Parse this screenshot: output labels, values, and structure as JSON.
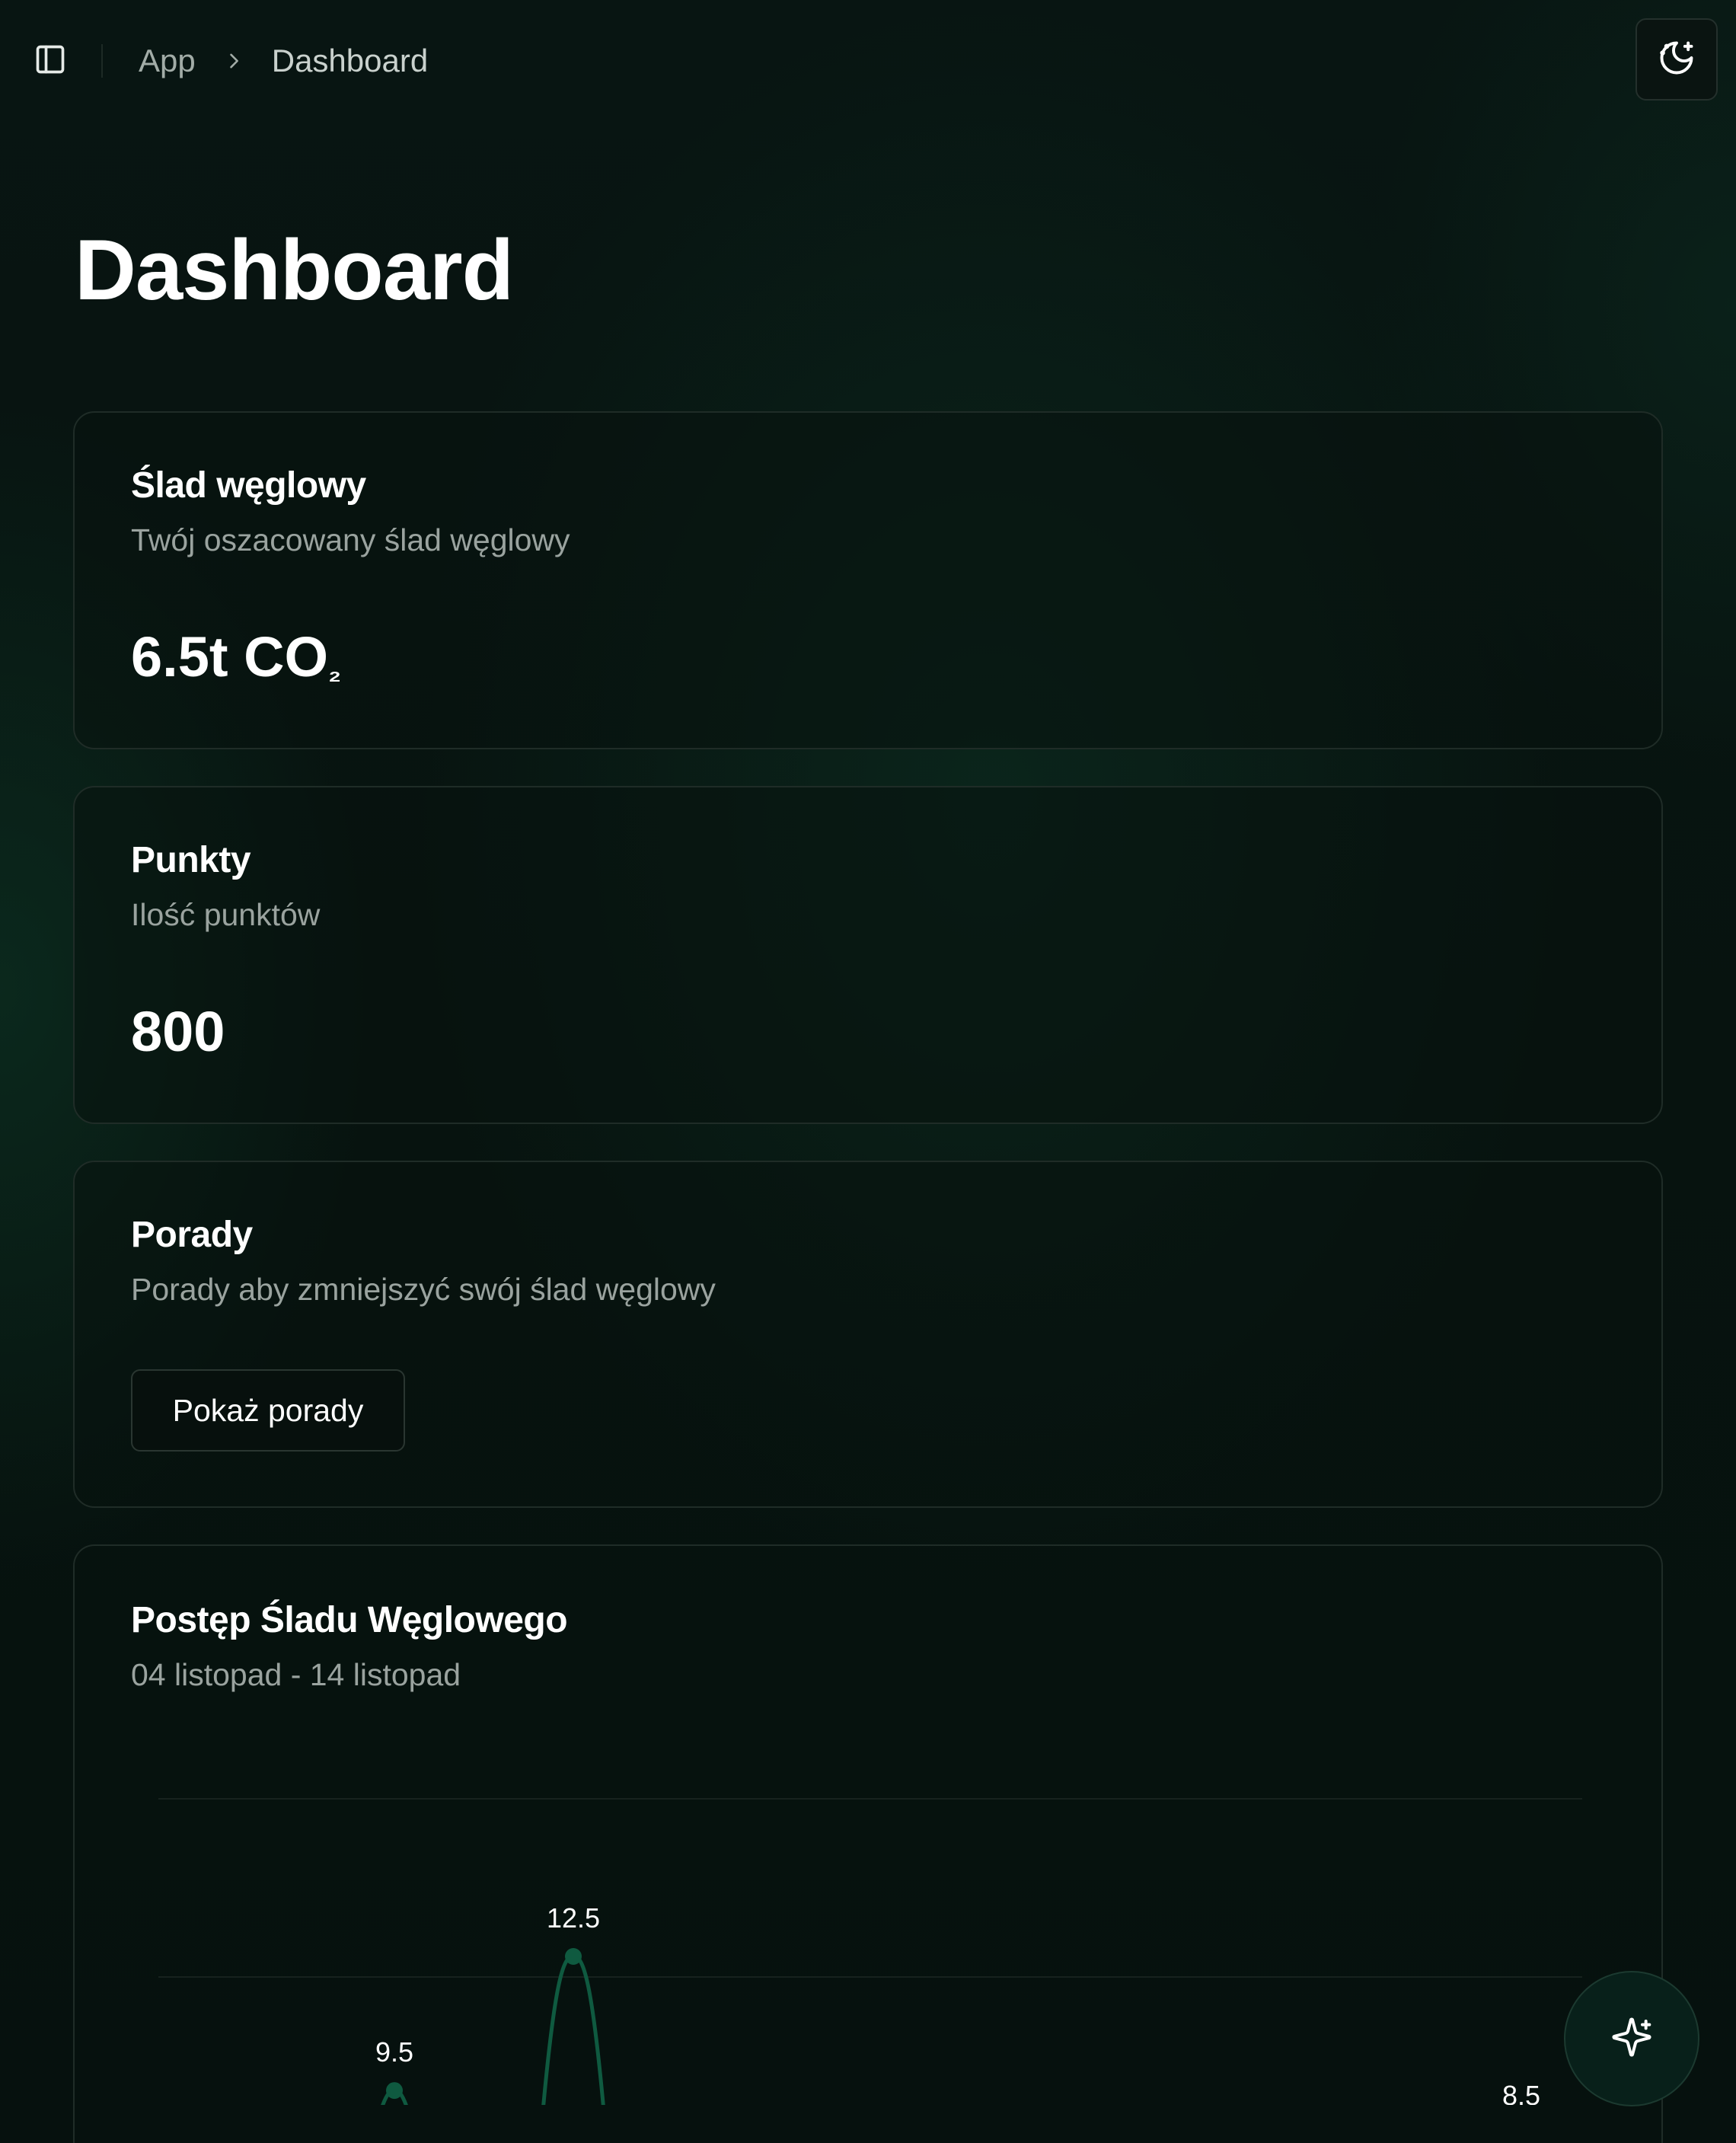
{
  "breadcrumb": {
    "items": [
      "App",
      "Dashboard"
    ]
  },
  "header": {
    "title": "Dashboard"
  },
  "icons": {
    "sidebar": "sidebar-toggle-icon",
    "chevron": "chevron-right-icon",
    "theme": "moon-stars-icon",
    "assistant": "sparkles-icon"
  },
  "cards": {
    "carbon": {
      "title": "Ślad węglowy",
      "description": "Twój oszacowany ślad węglowy",
      "value": "6.5t CO",
      "value_sub": "₂"
    },
    "points": {
      "title": "Punkty",
      "description": "Ilość punktów",
      "value": "800"
    },
    "tips": {
      "title": "Porady",
      "description": "Porady aby zmniejszyć swój ślad węglowy",
      "button_label": "Pokaż porady"
    },
    "progress": {
      "title": "Postęp Śladu Węglowego",
      "description": "04 listopad - 14 listopad"
    }
  },
  "colors": {
    "accent": "#0f5a40",
    "background": "#07120f",
    "card_border": "#1f2c27",
    "muted_text": "#9aa39f"
  },
  "chart_data": {
    "type": "line",
    "visible_points": [
      {
        "index": 0,
        "value": 9.5
      },
      {
        "index": 1,
        "value": 12.5
      },
      {
        "index": 7,
        "value": 8.5
      }
    ],
    "data_labels": [
      "9.5",
      "12.5",
      "8.5"
    ],
    "grid": true,
    "series_color": "#0f5a40"
  }
}
